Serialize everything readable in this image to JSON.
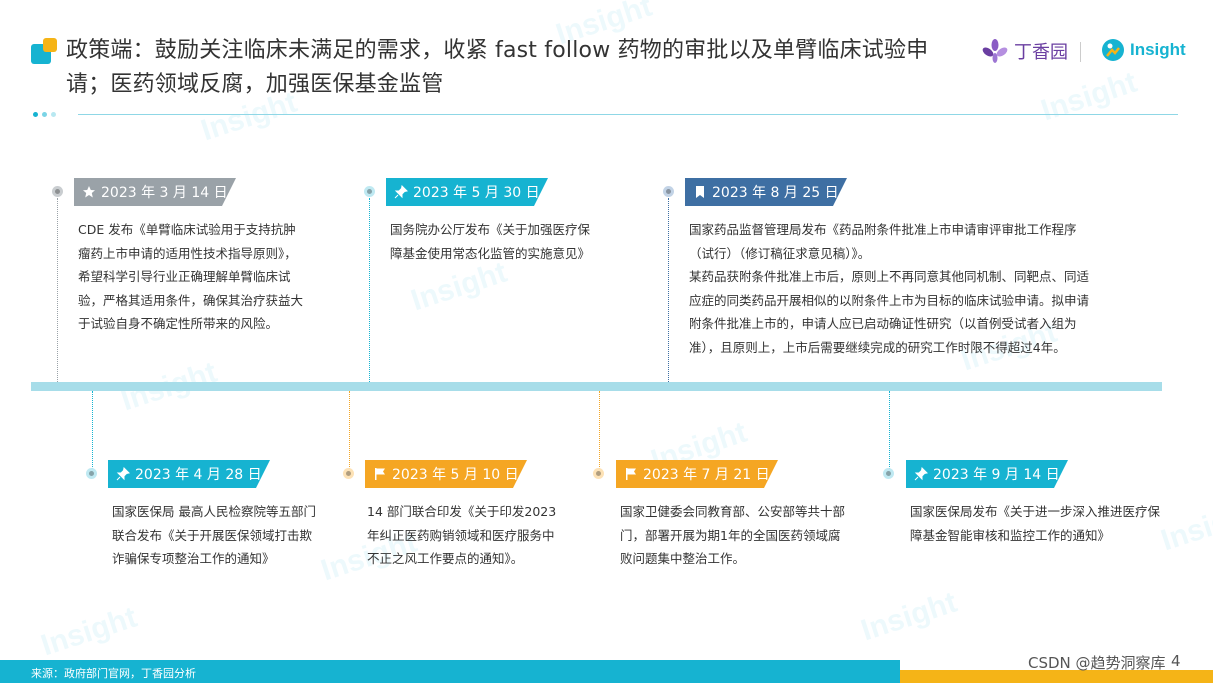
{
  "header": {
    "title": "政策端：鼓励关注临床未满足的需求，收紧 fast follow 药物的审批以及单臂临床试验申请；医药领域反腐，加强医保基金监管",
    "brand_dingxiang": "丁香园",
    "brand_insight": "Insight"
  },
  "colors": {
    "accent_cyan": "#16b3d1",
    "accent_orange": "#f5a623",
    "accent_navy": "#3e6fa3",
    "accent_gray": "#9aa2a8",
    "brand_purple": "#6a3ea1"
  },
  "watermark": "Insight",
  "timeline": {
    "top": [
      {
        "date": "2023 年 3 月 14 日",
        "icon": "star-icon",
        "text": "CDE 发布《单臂临床试验用于支持抗肿瘤药上市申请的适用性技术指导原则》，希望科学引导行业正确理解单臂临床试验，严格其适用条件，确保其治疗获益大于试验自身不确定性所带来的风险。"
      },
      {
        "date": "2023 年 5 月 30 日",
        "icon": "pin-icon",
        "text": "国务院办公厅发布《关于加强医疗保障基金使用常态化监管的实施意见》"
      },
      {
        "date": "2023 年 8 月 25 日",
        "icon": "bookmark-icon",
        "text": "国家药品监督管理局发布《药品附条件批准上市申请审评审批工作程序（试行）（修订稿征求意见稿）》。",
        "text2": "某药品获附条件批准上市后，原则上不再同意其他同机制、同靶点、同适应症的同类药品开展相似的以附条件上市为目标的临床试验申请。拟申请附条件批准上市的，申请人应已启动确证性研究（以首例受试者入组为准），且原则上，上市后需要继续完成的研究工作时限不得超过4年。"
      }
    ],
    "bottom": [
      {
        "date": "2023 年 4 月 28 日",
        "icon": "pin-icon",
        "text": "国家医保局  最高人民检察院等五部门联合发布《关于开展医保领域打击欺诈骗保专项整治工作的通知》"
      },
      {
        "date": "2023 年 5 月 10 日",
        "icon": "flag-icon",
        "text": "14 部门联合印发《关于印发2023年纠正医药购销领域和医疗服务中不正之风工作要点的通知》。"
      },
      {
        "date": "2023 年 7 月 21 日",
        "icon": "flag-icon",
        "text": "国家卫健委会同教育部、公安部等共十部门，部署开展为期1年的全国医药领域腐败问题集中整治工作。"
      },
      {
        "date": "2023 年 9 月 14 日",
        "icon": "pin-icon",
        "text": "国家医保局发布《关于进一步深入推进医疗保障基金智能审核和监控工作的通知》"
      }
    ]
  },
  "footer": {
    "source": "来源：政府部门官网，丁香园分析",
    "csdn": "CSDN @趋势洞察库",
    "page": "4"
  }
}
